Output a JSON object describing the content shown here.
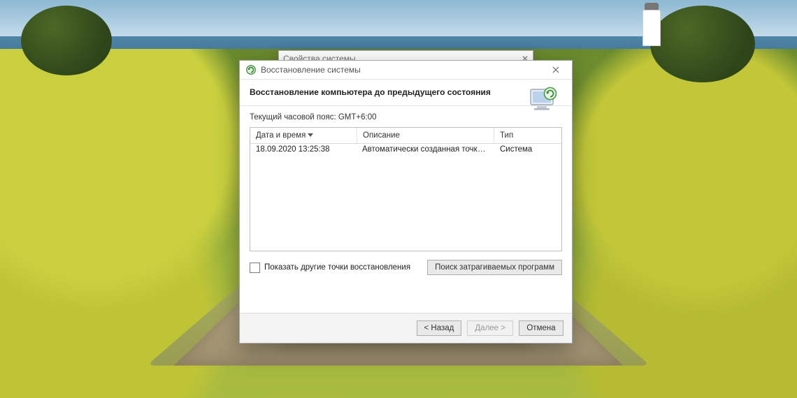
{
  "behind_window": {
    "title": "Свойства системы"
  },
  "dialog": {
    "title": "Восстановление системы",
    "heading": "Восстановление компьютера до предыдущего состояния",
    "timezone_label": "Текущий часовой пояс: GMT+6:00",
    "columns": {
      "datetime": "Дата и время",
      "description": "Описание",
      "type": "Тип"
    },
    "rows": [
      {
        "datetime": "18.09.2020 13:25:38",
        "description": "Автоматически созданная точка восстановле…",
        "type": "Система"
      }
    ],
    "show_more_label": "Показать другие точки восстановления",
    "scan_button": "Поиск затрагиваемых программ",
    "buttons": {
      "back": "< Назад",
      "next": "Далее >",
      "cancel": "Отмена"
    }
  }
}
